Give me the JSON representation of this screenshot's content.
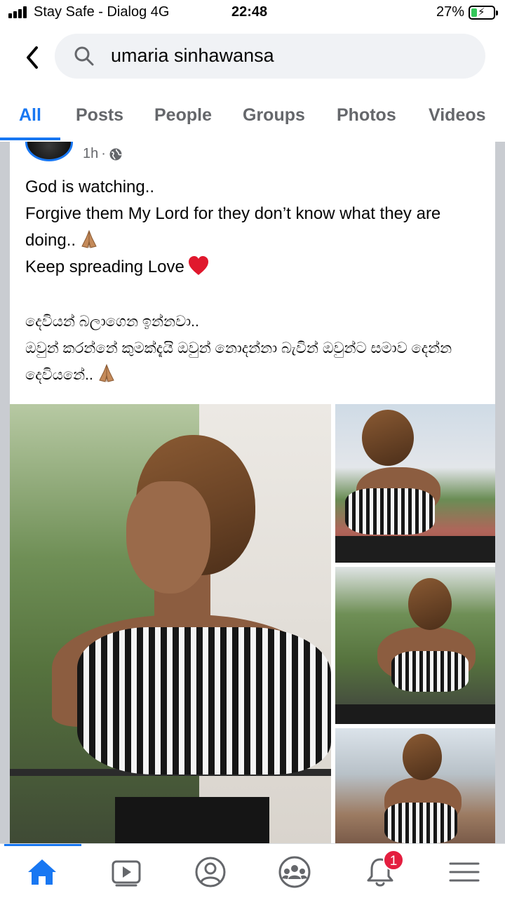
{
  "status_bar": {
    "carrier": "Stay Safe - Dialog  4G",
    "time": "22:48",
    "battery_percent": "27%",
    "battery_level": 0.27,
    "icons": [
      "signal-icon",
      "battery-charging-icon"
    ]
  },
  "header": {
    "search_value": "umaria sinhawansa",
    "icons": [
      "back-icon",
      "search-icon"
    ]
  },
  "tabs": [
    {
      "label": "All",
      "active": true
    },
    {
      "label": "Posts"
    },
    {
      "label": "People"
    },
    {
      "label": "Groups"
    },
    {
      "label": "Photos"
    },
    {
      "label": "Videos"
    }
  ],
  "post": {
    "time": "1h",
    "separator": "·",
    "privacy_icon": "globe-icon",
    "text_en": [
      "God is watching..",
      "Forgive them My Lord for they don’t know what they are doing..",
      "Keep spreading Love"
    ],
    "text_si": [
      "දෙවියන් බලාගෙන ඉන්නවා..",
      "ඔවුන් කරන්නේ කුමක්දැයි ඔවුන් නොදන්නා බැවින් ඔවුන්ට සමාව දෙන්න දෙවියනේ.."
    ],
    "emojis": [
      "folded-hands-icon",
      "red-heart-icon"
    ],
    "photos": [
      "main-photo",
      "photo-2",
      "photo-3",
      "photo-4"
    ]
  },
  "bottom_nav": {
    "items": [
      "home-icon",
      "watch-icon",
      "profile-icon",
      "groups-icon",
      "notifications-icon",
      "menu-icon"
    ],
    "notification_count": "1",
    "active_color": "#1877f2",
    "inactive_color": "#65676b"
  }
}
